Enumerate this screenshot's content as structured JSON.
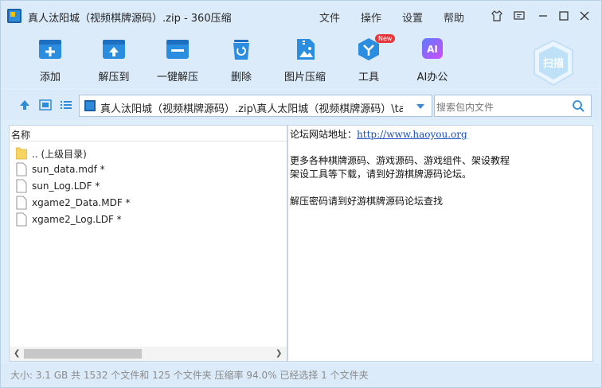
{
  "title": "真人汰阳城（视频棋牌源码）.zip - 360压缩",
  "menu": [
    "文件",
    "操作",
    "设置",
    "帮助"
  ],
  "toolbar": [
    {
      "label": "添加",
      "icon": "add-icon"
    },
    {
      "label": "解压到",
      "icon": "extract-to-icon"
    },
    {
      "label": "一键解压",
      "icon": "one-click-extract-icon"
    },
    {
      "label": "删除",
      "icon": "delete-icon"
    },
    {
      "label": "图片压缩",
      "icon": "image-compress-icon"
    },
    {
      "label": "工具",
      "icon": "tools-icon",
      "badge": "New"
    },
    {
      "label": "AI办公",
      "icon": "ai-office-icon",
      "icon_text": "AI"
    }
  ],
  "scan_label": "扫描",
  "address": "真人汰阳城（视频棋牌源码）.zip\\真人太阳城（视频棋牌源码）\\taiyang",
  "search_placeholder": "搜索包内文件",
  "list_header": "名称",
  "files": [
    {
      "name": ".. (上级目录)",
      "type": "folder"
    },
    {
      "name": "sun_data.mdf *",
      "type": "file"
    },
    {
      "name": "sun_Log.LDF *",
      "type": "file"
    },
    {
      "name": "xgame2_Data.MDF *",
      "type": "file"
    },
    {
      "name": "xgame2_Log.LDF *",
      "type": "file"
    }
  ],
  "info": {
    "forum_prefix": "论坛网站地址：",
    "forum_url": "http://www.haoyou.org",
    "line2": "更多各种棋牌源码、游戏源码、游戏组件、架设教程",
    "line3": "架设工具等下载，请到好游棋牌源码论坛。",
    "line4": "解压密码请到好游棋牌源码论坛查找"
  },
  "status": "大小: 3.1 GB 共 1532 个文件和 125 个文件夹 压缩率 94.0% 已经选择 1 个文件夹",
  "colors": {
    "accent": "#2f8cd8",
    "chrome": "#dcebfa",
    "link": "#1a4fc4"
  }
}
